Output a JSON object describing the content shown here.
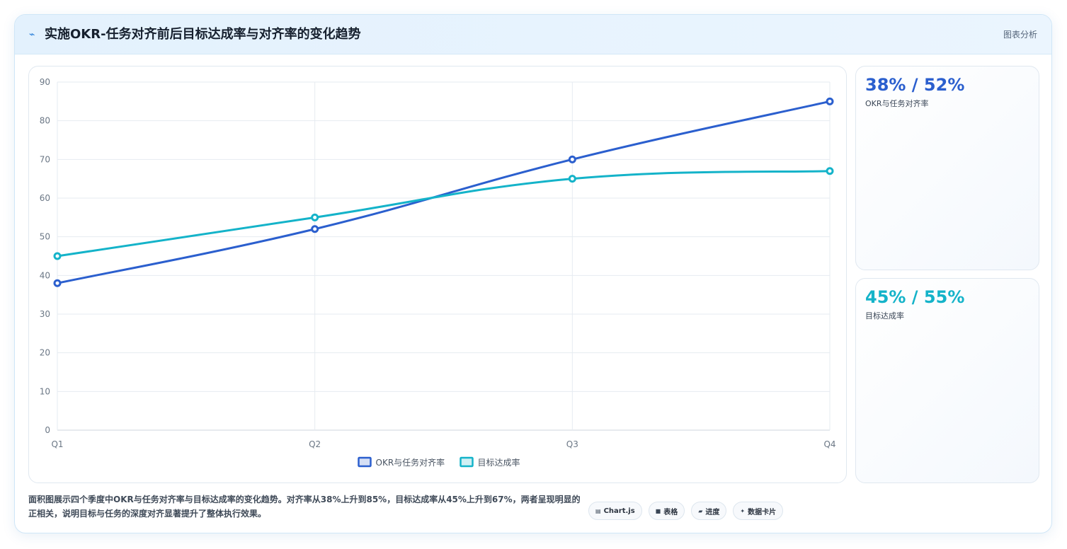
{
  "header": {
    "title": "实施OKR-任务对齐前后目标达成率与对齐率的变化趋势",
    "right_label": "图表分析",
    "icon": "trend-icon"
  },
  "colors": {
    "series1": "#2b5fce",
    "series2": "#14b3c9",
    "grid": "#e6ebf1",
    "tick": "#6b7785"
  },
  "chart_data": {
    "type": "line",
    "categories": [
      "Q1",
      "Q2",
      "Q3",
      "Q4"
    ],
    "series": [
      {
        "name": "OKR与任务对齐率",
        "values": [
          38,
          52,
          70,
          85
        ]
      },
      {
        "name": "目标达成率",
        "values": [
          45,
          55,
          65,
          67
        ]
      }
    ],
    "ylim": [
      0,
      90
    ],
    "yticks": [
      0,
      10,
      20,
      30,
      40,
      50,
      60,
      70,
      80,
      90
    ],
    "grid": true,
    "legend": "bottom"
  },
  "stats": [
    {
      "value": "38% / 52%",
      "label": "OKR与任务对齐率",
      "color": "#2b5fce"
    },
    {
      "value": "45% / 55%",
      "label": "目标达成率",
      "color": "#14b3c9"
    }
  ],
  "footer": {
    "description": "面积图展示四个季度中OKR与任务对齐率与目标达成率的变化趋势。对齐率从38%上升到85%，目标达成率从45%上升到67%，两者呈现明显的正相关，说明目标与任务的深度对齐显著提升了整体执行效果。",
    "chips": [
      {
        "icon": "▤",
        "label": "Chart.js"
      },
      {
        "icon": "■",
        "label": "表格"
      },
      {
        "icon": "▰",
        "label": "进度"
      },
      {
        "icon": "✦",
        "label": "数据卡片"
      }
    ]
  }
}
